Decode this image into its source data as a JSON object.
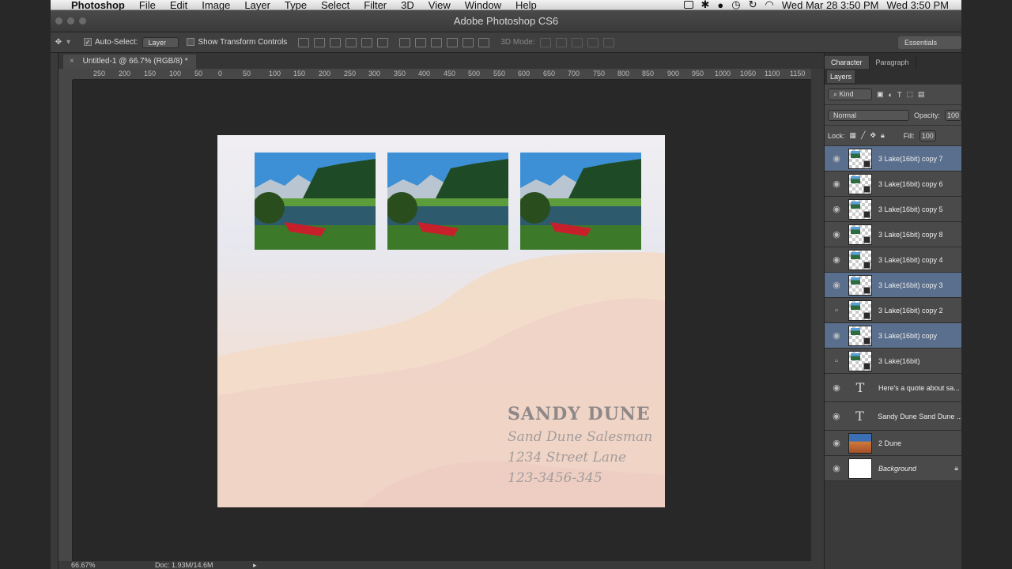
{
  "menubar": {
    "app_name": "Photoshop",
    "items": [
      "File",
      "Edit",
      "Image",
      "Layer",
      "Type",
      "Select",
      "Filter",
      "3D",
      "View",
      "Window",
      "Help"
    ],
    "clock1": "Wed Mar 28  3:50 PM",
    "clock2": "Wed 3:50 PM"
  },
  "window": {
    "title": "Adobe Photoshop CS6"
  },
  "options": {
    "auto_select_label": "Auto-Select:",
    "auto_select_value": "Layer",
    "transform_label": "Show Transform Controls",
    "mode3d_label": "3D Mode:",
    "workspace": "Essentials"
  },
  "document": {
    "tab_label": "Untitled-1 @ 66.7% (RGB/8) *",
    "ruler_ticks": [
      "250",
      "200",
      "150",
      "100",
      "50",
      "0",
      "50",
      "100",
      "150",
      "200",
      "250",
      "300",
      "350",
      "400",
      "450",
      "500",
      "550",
      "600",
      "650",
      "700",
      "750",
      "800",
      "850",
      "900",
      "950",
      "1000",
      "1050",
      "1100",
      "1150"
    ],
    "card": {
      "name": "SANDY DUNE",
      "title": "Sand Dune Salesman",
      "address": "1234 Street Lane",
      "phone": "123-3456-345"
    }
  },
  "status": {
    "zoom": "66.67%",
    "doc": "Doc: 1.93M/14.6M"
  },
  "panels": {
    "tabs": [
      "Character",
      "Paragraph"
    ],
    "layers_tab": "Layers",
    "kind_label": "Kind",
    "blend_mode": "Normal",
    "opacity_label": "Opacity:",
    "opacity_value": "100",
    "lock_label": "Lock:",
    "fill_label": "Fill:",
    "fill_value": "100",
    "layers": [
      {
        "name": "3 Lake(16bit) copy 7",
        "kind": "smart",
        "visible": true,
        "selected": true
      },
      {
        "name": "3 Lake(16bit) copy 6",
        "kind": "smart",
        "visible": true,
        "selected": false
      },
      {
        "name": "3 Lake(16bit) copy 5",
        "kind": "smart",
        "visible": true,
        "selected": false
      },
      {
        "name": "3 Lake(16bit) copy 8",
        "kind": "smart",
        "visible": true,
        "selected": false
      },
      {
        "name": "3 Lake(16bit) copy 4",
        "kind": "smart",
        "visible": true,
        "selected": false
      },
      {
        "name": "3 Lake(16bit) copy 3",
        "kind": "smart",
        "visible": true,
        "selected": true
      },
      {
        "name": "3 Lake(16bit) copy 2",
        "kind": "smart",
        "visible": false,
        "selected": false
      },
      {
        "name": "3 Lake(16bit) copy",
        "kind": "smart",
        "visible": true,
        "selected": true
      },
      {
        "name": "3 Lake(16bit)",
        "kind": "smart",
        "visible": false,
        "selected": false
      },
      {
        "name": "Here's a quote about sa...",
        "kind": "text",
        "visible": true,
        "selected": false
      },
      {
        "name": "Sandy Dune Sand Dune ...",
        "kind": "text",
        "visible": true,
        "selected": false
      },
      {
        "name": "2 Dune",
        "kind": "image",
        "visible": true,
        "selected": false
      },
      {
        "name": "Background",
        "kind": "background",
        "visible": true,
        "selected": false
      }
    ]
  }
}
